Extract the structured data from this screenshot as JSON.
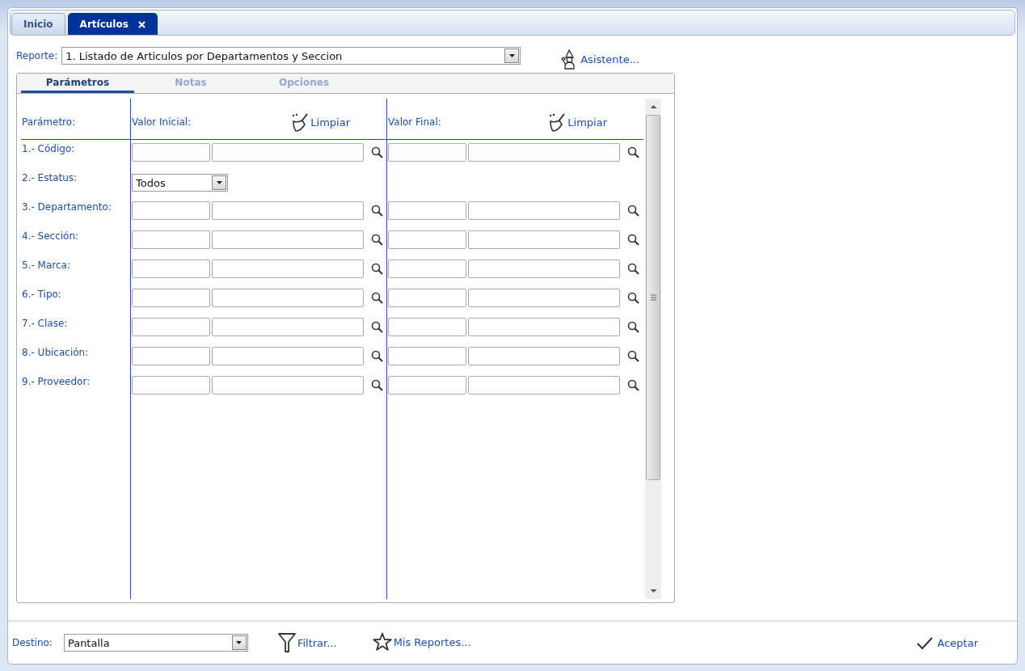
{
  "tabs": [
    {
      "label": "Inicio",
      "selected": false,
      "closable": false
    },
    {
      "label": "Artículos",
      "selected": true,
      "closable": true
    }
  ],
  "report": {
    "label": "Reporte:",
    "value": "1. Listado de Articulos por Departamentos y Seccion"
  },
  "assistant": "Asistente...",
  "subtabs": [
    {
      "label": "Parámetros",
      "selected": true
    },
    {
      "label": "Notas",
      "selected": false
    },
    {
      "label": "Opciones",
      "selected": false
    }
  ],
  "params": {
    "header": "Parámetro:",
    "initial": {
      "label": "Valor Inicial:",
      "clear": "Limpiar"
    },
    "final": {
      "label": "Valor Final:",
      "clear": "Limpiar"
    },
    "rows": [
      {
        "label": "1.- Código:",
        "kind": "range"
      },
      {
        "label": "2.- Estatus:",
        "kind": "select",
        "value": "Todos"
      },
      {
        "label": "3.- Departamento:",
        "kind": "range"
      },
      {
        "label": "4.- Sección:",
        "kind": "range"
      },
      {
        "label": "5.- Marca:",
        "kind": "range"
      },
      {
        "label": "6.- Tipo:",
        "kind": "range"
      },
      {
        "label": "7.- Clase:",
        "kind": "range"
      },
      {
        "label": "8.- Ubicación:",
        "kind": "range"
      },
      {
        "label": "9.- Proveedor:",
        "kind": "range"
      }
    ]
  },
  "footer": {
    "destination_label": "Destino:",
    "destination": "Pantalla",
    "filter": "Filtrar...",
    "my_reports": "Mis Reportes...",
    "accept": "Aceptar"
  }
}
